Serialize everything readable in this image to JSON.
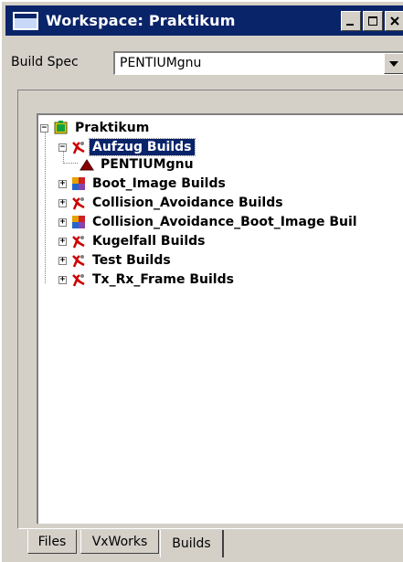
{
  "window": {
    "title": "Workspace: Praktikum",
    "minimize_label": "_",
    "maximize_label": "□",
    "close_label": "x"
  },
  "build_spec": {
    "label": "Build Spec",
    "value": "PENTIUMgnu"
  },
  "tree": {
    "root": {
      "label": "Praktikum",
      "expander": "−",
      "icon": "workspace-icon"
    },
    "nodes": [
      {
        "label": "Aufzug Builds",
        "expander": "−",
        "icon": "builds-icon",
        "selected": true
      },
      {
        "label": "PENTIUMgnu",
        "icon": "build-target-icon",
        "child": true
      },
      {
        "label": "Boot_Image Builds",
        "expander": "+",
        "icon": "boot-image-builds-icon"
      },
      {
        "label": "Collision_Avoidance Builds",
        "expander": "+",
        "icon": "builds-icon"
      },
      {
        "label": "Collision_Avoidance_Boot_Image Buil",
        "expander": "+",
        "icon": "boot-image-builds-icon"
      },
      {
        "label": "Kugelfall Builds",
        "expander": "+",
        "icon": "builds-icon"
      },
      {
        "label": "Test Builds",
        "expander": "+",
        "icon": "builds-icon"
      },
      {
        "label": "Tx_Rx_Frame Builds",
        "expander": "+",
        "icon": "builds-icon"
      }
    ]
  },
  "tabs": [
    {
      "label": "Files",
      "active": false
    },
    {
      "label": "VxWorks",
      "active": false
    },
    {
      "label": "Builds",
      "active": true
    }
  ],
  "colors": {
    "titlebar": "#0a246a",
    "face": "#d4d0c8",
    "selection": "#0a246a"
  }
}
